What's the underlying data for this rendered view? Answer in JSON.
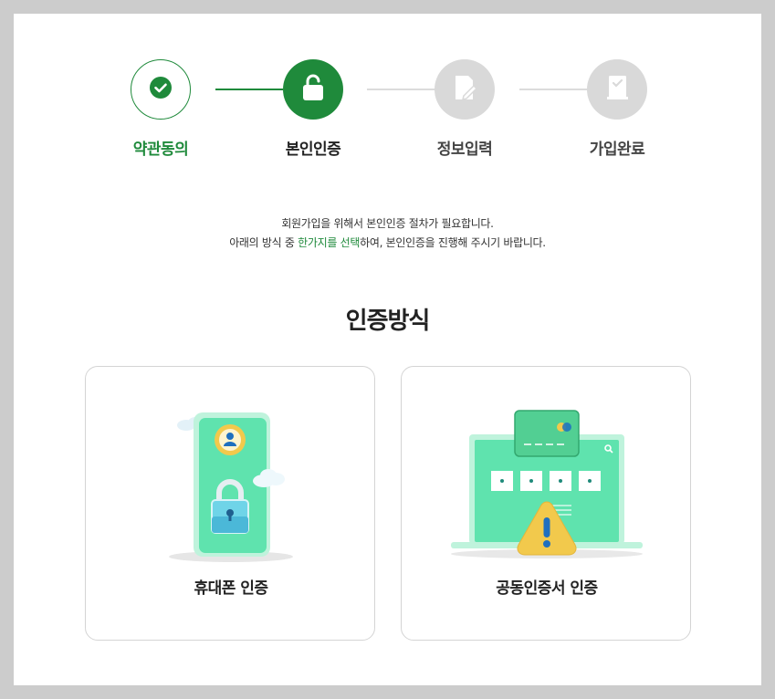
{
  "steps": [
    {
      "label": "약관동의",
      "state": "done",
      "icon": "check-icon"
    },
    {
      "label": "본인인증",
      "state": "active",
      "icon": "unlock-icon"
    },
    {
      "label": "정보입력",
      "state": "pending",
      "icon": "edit-icon"
    },
    {
      "label": "가입완료",
      "state": "pending",
      "icon": "document-check-icon"
    }
  ],
  "description": {
    "line1": "회원가입을 위해서 본인인증 절차가 필요합니다.",
    "line2_pre": "아래의 방식 중 ",
    "line2_highlight": "한가지를 선택",
    "line2_post": "하여, 본인인증을 진행해 주시기 바랍니다."
  },
  "section_title": "인증방식",
  "methods": [
    {
      "label": "휴대폰 인증",
      "icon": "phone-lock-icon"
    },
    {
      "label": "공동인증서 인증",
      "icon": "certificate-laptop-icon"
    }
  ],
  "colors": {
    "accent": "#1f8a3b",
    "pending": "#d9d9d9",
    "mint": "#5fe3ae",
    "warning": "#f2c94c"
  }
}
